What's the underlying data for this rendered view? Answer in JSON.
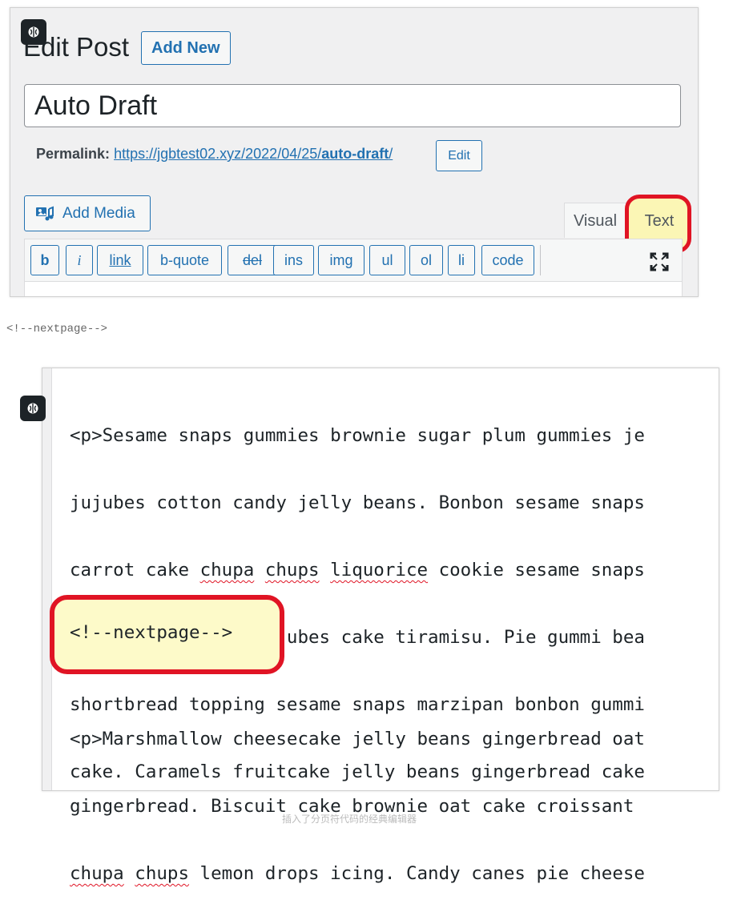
{
  "editor": {
    "page_title": "Edit Post",
    "add_new_label": "Add New",
    "post_title": "Auto Draft",
    "permalink": {
      "label": "Permalink:",
      "url_base": "https://jgbtest02.xyz/2022/04/25/",
      "url_slug": "auto-draft",
      "url_trailing": "/",
      "edit_label": "Edit"
    },
    "add_media_label": "Add Media",
    "tabs": {
      "visual": "Visual",
      "text": "Text"
    },
    "quicktags": [
      "b",
      "i",
      "link",
      "b-quote",
      "del",
      "ins",
      "img",
      "ul",
      "ol",
      "li",
      "code"
    ]
  },
  "caption": "<!--nextpage-->",
  "code_view": {
    "lines_before": [
      {
        "parts": [
          "<p>Sesame snaps gummies brownie sugar plum gummies je"
        ]
      },
      {
        "parts": [
          "jujubes cotton candy jelly beans. Bonbon sesame snaps"
        ]
      },
      {
        "parts": [
          "carrot cake ",
          "chupa",
          " ",
          "chups",
          " ",
          "liquorice",
          " cookie sesame snaps"
        ]
      },
      {
        "parts": [
          "soufflé cake pie jujubes cake tiramisu. Pie gummi bea"
        ]
      },
      {
        "parts": [
          "shortbread topping sesame snaps marzipan bonbon gummi"
        ]
      },
      {
        "parts": [
          "cake. Caramels fruitcake jelly beans gingerbread cake"
        ]
      }
    ],
    "nextpage_tag": "<!--nextpage-->",
    "lines_after": [
      {
        "parts": [
          "<p>Marshmallow cheesecake jelly beans gingerbread oat"
        ]
      },
      {
        "parts": [
          "gingerbread. Biscuit cake brownie oat cake croissant "
        ]
      },
      {
        "parts": [
          "chupa",
          " ",
          "chups",
          " lemon drops icing. Candy canes pie cheese"
        ]
      }
    ]
  },
  "bottom_caption": "插入了分页符代码的经典编辑器",
  "colors": {
    "accent": "#2271b1",
    "highlight_ring": "#e01424",
    "highlight_fill": "#fdfac9"
  }
}
